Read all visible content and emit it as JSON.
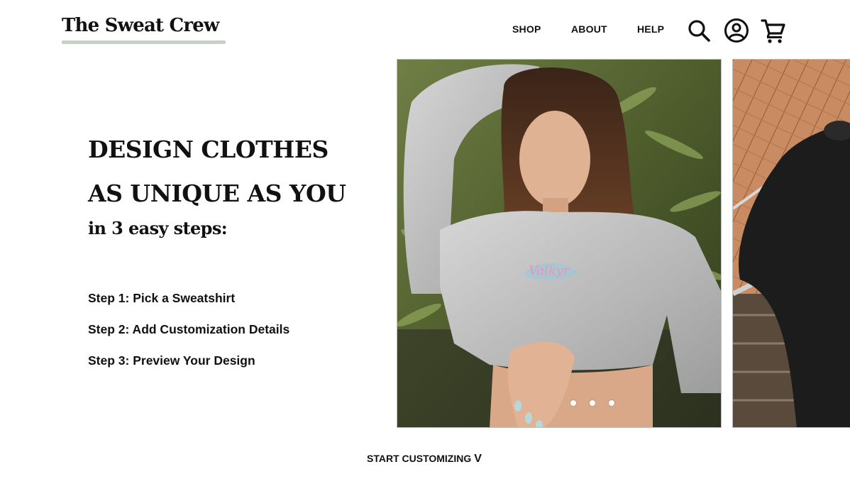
{
  "header": {
    "logo_text": "The Sweat Crew",
    "nav": [
      {
        "label": "SHOP"
      },
      {
        "label": "ABOUT"
      },
      {
        "label": "HELP"
      }
    ],
    "icons": [
      "search-icon",
      "account-icon",
      "cart-icon"
    ]
  },
  "hero": {
    "headline_line1": "DESIGN CLOTHES",
    "headline_line2": "AS UNIQUE AS YOU",
    "subhead": "in 3 easy steps:",
    "steps": [
      "Step 1: Pick a Sweatshirt",
      "Step 2: Add Customization Details",
      "Step 3: Preview Your Design"
    ]
  },
  "carousel": {
    "slides_count": 3,
    "active_slide": 1,
    "sweatshirt_logo_text": "Valkyr"
  },
  "cta": {
    "label": "START CUSTOMIZING",
    "chevron": "V"
  },
  "colors": {
    "text": "#111111",
    "logo_underline": "#c5d2c3",
    "background": "#ffffff",
    "dot": "#ffffff"
  }
}
